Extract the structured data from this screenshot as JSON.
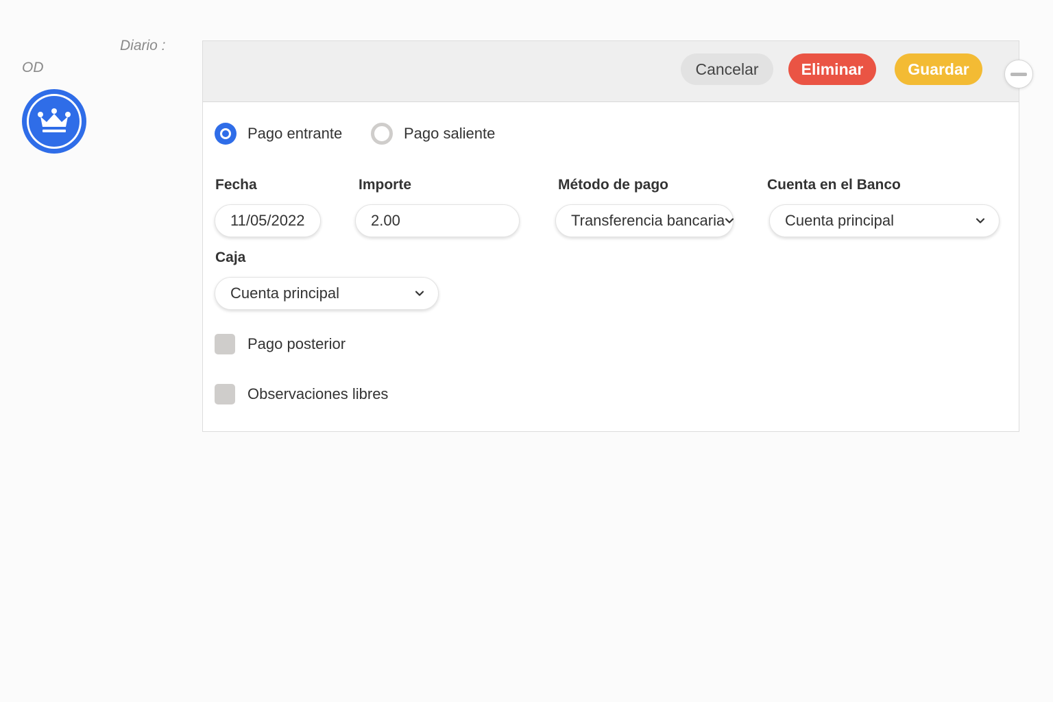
{
  "header": {
    "diario_label": "Diario :",
    "journal_code": "OD",
    "avatar_icon": "crown-icon"
  },
  "toolbar": {
    "cancel_label": "Cancelar",
    "delete_label": "Eliminar",
    "save_label": "Guardar",
    "collapse_icon": "minus-icon"
  },
  "payment_type": {
    "options": [
      {
        "label": "Pago entrante",
        "selected": true
      },
      {
        "label": "Pago saliente",
        "selected": false
      }
    ]
  },
  "form": {
    "fecha": {
      "label": "Fecha",
      "value": "11/05/2022"
    },
    "importe": {
      "label": "Importe",
      "value": "2.00"
    },
    "metodo_pago": {
      "label": "Método de pago",
      "value": "Transferencia bancaria"
    },
    "cuenta_banco": {
      "label": "Cuenta en el Banco",
      "value": "Cuenta principal"
    },
    "caja": {
      "label": "Caja",
      "value": "Cuenta principal"
    }
  },
  "options": {
    "pago_posterior": {
      "label": "Pago posterior",
      "checked": false
    },
    "observaciones": {
      "label": "Observaciones libres",
      "checked": false
    }
  },
  "colors": {
    "accent_blue": "#2f6de8",
    "delete_red": "#ea5444",
    "save_yellow": "#f3bb34"
  }
}
